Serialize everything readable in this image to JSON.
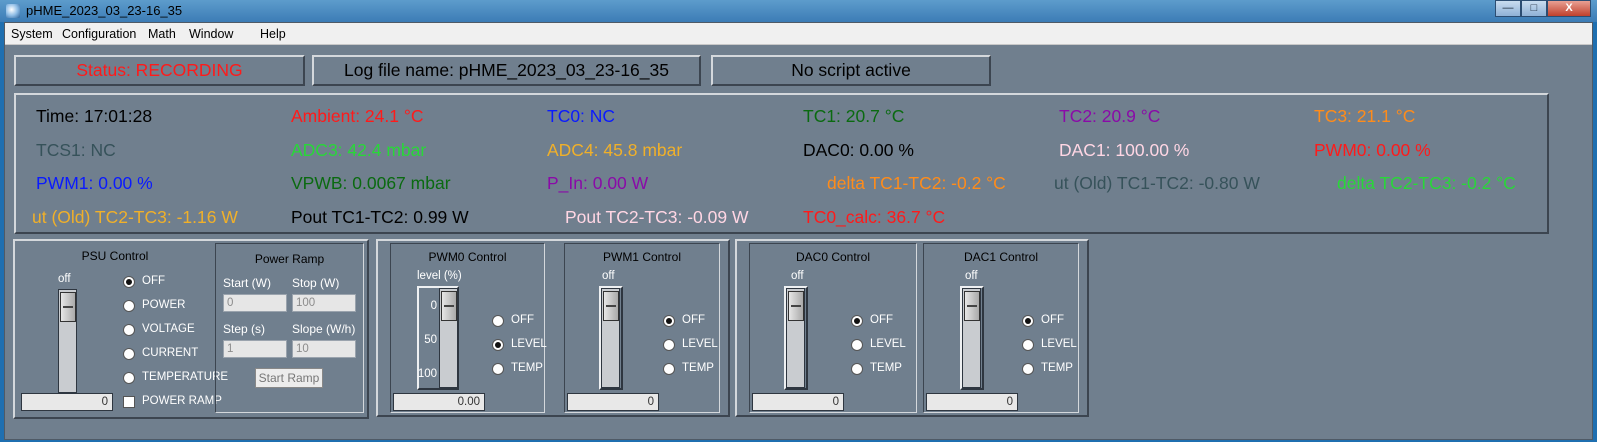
{
  "window": {
    "title": "pHME_2023_03_23-16_35",
    "minimize": "—",
    "maximize": "□",
    "close": "X"
  },
  "menu": [
    "System",
    "Configuration",
    "Math",
    "Window",
    "Help"
  ],
  "status": {
    "recording": "Status: RECORDING",
    "logfile": "Log file name: pHME_2023_03_23-16_35",
    "script": "No script active"
  },
  "readouts": [
    {
      "text": "Time: 17:01:28",
      "color": "#000000"
    },
    {
      "text": "Ambient: 24.1 °C",
      "color": "#ff1a1a"
    },
    {
      "text": "TC0: NC",
      "color": "#0a1aff"
    },
    {
      "text": "TC1: 20.7 °C",
      "color": "#0a6a10"
    },
    {
      "text": "TC2: 20.9 °C",
      "color": "#8a0aa8"
    },
    {
      "text": "TC3: 21.1 °C",
      "color": "#ff8c1a"
    },
    {
      "text": "TCS1: NC",
      "color": "#36525a"
    },
    {
      "text": "ADC3: 42.4 mbar",
      "color": "#28d838"
    },
    {
      "text": "ADC4: 45.8 mbar",
      "color": "#f0b02a"
    },
    {
      "text": "DAC0: 0.00 %",
      "color": "#000000"
    },
    {
      "text": "DAC1: 100.00 %",
      "color": "#ffd6e4"
    },
    {
      "text": "PWM0: 0.00 %",
      "color": "#ff1a1a"
    },
    {
      "text": "PWM1: 0.00 %",
      "color": "#0a1aff"
    },
    {
      "text": "VPWB: 0.0067 mbar",
      "color": "#0a6a10"
    },
    {
      "text": "P_In: 0.00 W",
      "color": "#8a0aa8"
    },
    {
      "text": "delta TC1-TC2: -0.2 °C",
      "color": "#ff8c1a"
    },
    {
      "text": "ut (Old) TC1-TC2: -0.80 W",
      "color": "#36525a"
    },
    {
      "text": "delta TC2-TC3: -0.2 °C",
      "color": "#28d838"
    },
    {
      "text": "ut (Old) TC2-TC3: -1.16 W",
      "color": "#f0b02a"
    },
    {
      "text": "Pout TC1-TC2: 0.99 W",
      "color": "#000000"
    },
    {
      "text": "Pout TC2-TC3: -0.09 W",
      "color": "#ffd6e4"
    },
    {
      "text": "TC0_calc: 36.7 °C",
      "color": "#ff1a1a"
    }
  ],
  "psu": {
    "title": "PSU Control",
    "slider_label": "off",
    "value": "0",
    "options": [
      "OFF",
      "POWER",
      "VOLTAGE",
      "CURRENT",
      "TEMPERATURE"
    ],
    "selected": "OFF",
    "checkbox": "POWER RAMP",
    "ramp": {
      "title": "Power Ramp",
      "start_label": "Start (W)",
      "stop_label": "Stop (W)",
      "step_label": "Step (s)",
      "slope_label": "Slope (W/h)",
      "start": "0",
      "stop": "100",
      "step": "1",
      "slope": "10",
      "button": "Start Ramp"
    }
  },
  "pwm0": {
    "title": "PWM0 Control",
    "slider_label": "level (%)",
    "ticks": [
      "0",
      "50",
      "100"
    ],
    "value": "0.00",
    "options": [
      "OFF",
      "LEVEL",
      "TEMP"
    ],
    "selected": "LEVEL"
  },
  "pwm1": {
    "title": "PWM1 Control",
    "slider_label": "off",
    "value": "0",
    "options": [
      "OFF",
      "LEVEL",
      "TEMP"
    ],
    "selected": "OFF"
  },
  "dac0": {
    "title": "DAC0 Control",
    "slider_label": "off",
    "value": "0",
    "options": [
      "OFF",
      "LEVEL",
      "TEMP"
    ],
    "selected": "OFF"
  },
  "dac1": {
    "title": "DAC1 Control",
    "slider_label": "off",
    "value": "0",
    "options": [
      "OFF",
      "LEVEL",
      "TEMP"
    ],
    "selected": "OFF"
  }
}
